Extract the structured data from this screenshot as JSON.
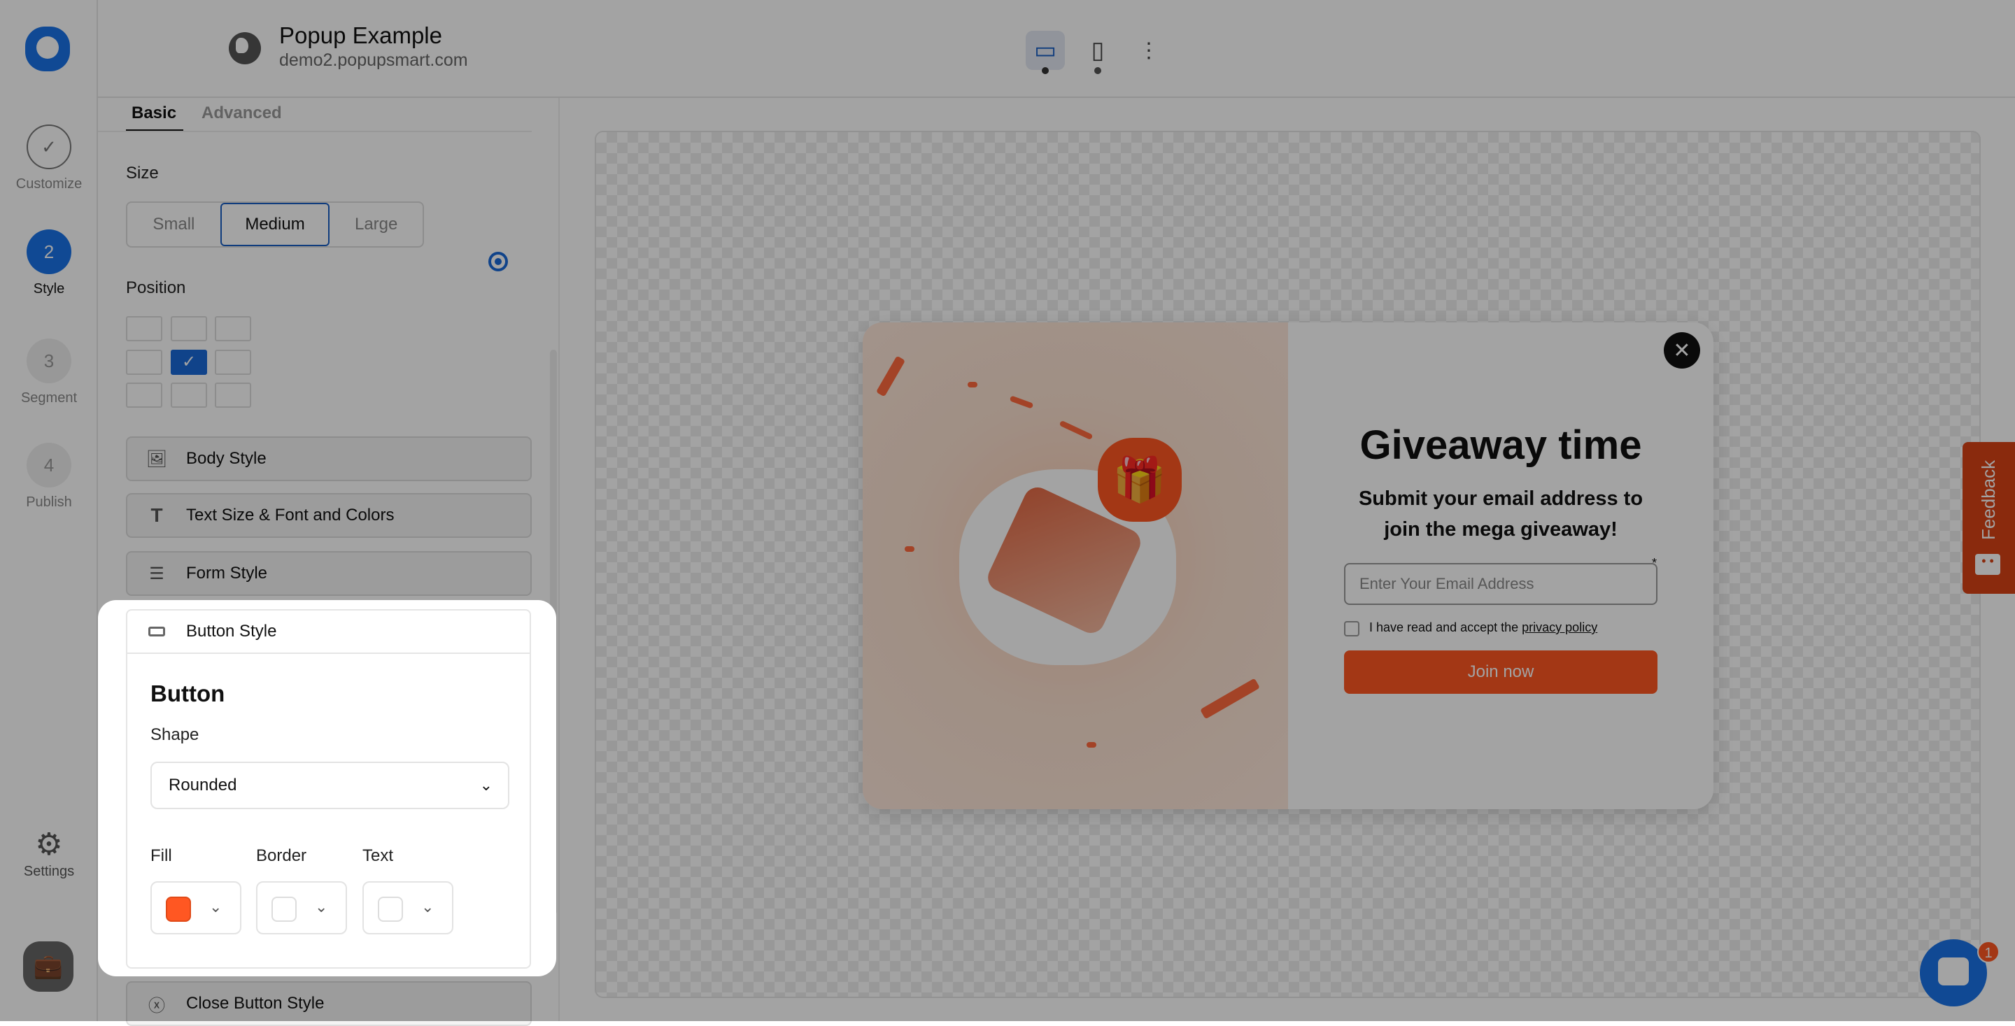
{
  "app": {
    "title": "Popup Example",
    "domain": "demo2.popupsmart.com"
  },
  "rail": {
    "steps": [
      {
        "num": "✓",
        "label": "Customize"
      },
      {
        "num": "2",
        "label": "Style"
      },
      {
        "num": "3",
        "label": "Segment"
      },
      {
        "num": "4",
        "label": "Publish"
      }
    ],
    "settings": "Settings"
  },
  "tabs": [
    "Basic",
    "Advanced"
  ],
  "size": {
    "label": "Size",
    "options": [
      "Small",
      "Medium",
      "Large"
    ],
    "selected": "Medium"
  },
  "position": {
    "label": "Position",
    "selected": "center-left"
  },
  "sections": [
    "Body Style",
    "Text Size & Font and Colors",
    "Form Style",
    "Button Style",
    "Close Button Style"
  ],
  "button_panel": {
    "title": "Button",
    "shape_label": "Shape",
    "shape_value": "Rounded",
    "fill_label": "Fill",
    "border_label": "Border",
    "text_label": "Text",
    "fill_color": "#ff5722",
    "border_color": "#ffffff",
    "text_color": "#ffffff"
  },
  "popup": {
    "heading": "Giveaway time",
    "sub1": "Submit your email address to",
    "sub2": "join the mega giveaway!",
    "email_placeholder": "Enter Your Email Address",
    "required": "*",
    "consent": "I have read and accept the ",
    "policy": "privacy policy",
    "cta": "Join now",
    "accent": "#ff5722"
  },
  "widgets": {
    "feedback": "Feedback",
    "chat_badge": "1"
  }
}
